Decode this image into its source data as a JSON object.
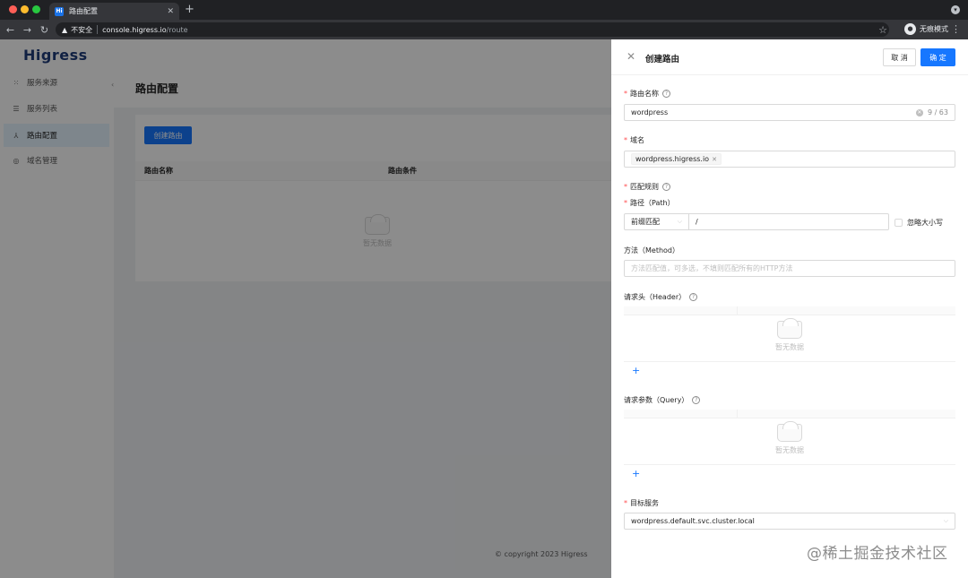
{
  "browser": {
    "tab_title": "路由配置",
    "tab_favicon": "Hi",
    "security_label": "不安全",
    "url_host": "console.higress.io",
    "url_path": "/route",
    "incognito_label": "无痕模式"
  },
  "sidebar": {
    "logo": "Higress",
    "items": [
      {
        "label": "服务来源",
        "icon": "nodes-icon"
      },
      {
        "label": "服务列表",
        "icon": "list-icon"
      },
      {
        "label": "路由配置",
        "icon": "route-icon",
        "active": true
      },
      {
        "label": "域名管理",
        "icon": "globe-icon"
      }
    ]
  },
  "page": {
    "title": "路由配置",
    "create_button": "创建路由",
    "table_headers": [
      "路由名称",
      "路由条件"
    ],
    "empty_text": "暂无数据",
    "copyright": "copyright 2023 Higress"
  },
  "drawer": {
    "title": "创建路由",
    "cancel_label": "取 消",
    "ok_label": "确 定",
    "route_name": {
      "label": "路由名称",
      "value": "wordpress",
      "counter": "9 / 63"
    },
    "domain": {
      "label": "域名",
      "tag": "wordpress.higress.io"
    },
    "match_rule": {
      "label": "匹配规则"
    },
    "path": {
      "label": "路径（Path）",
      "match_type": "前缀匹配",
      "value": "/",
      "ignore_case_label": "忽略大小写"
    },
    "method": {
      "label": "方法（Method）",
      "placeholder": "方法匹配值，可多选，不填则匹配所有的HTTP方法"
    },
    "header": {
      "label": "请求头（Header）",
      "empty_text": "暂无数据",
      "add_label": "+"
    },
    "query": {
      "label": "请求参数（Query）",
      "empty_text": "暂无数据",
      "add_label": "+"
    },
    "target_service": {
      "label": "目标服务",
      "value": "wordpress.default.svc.cluster.local"
    }
  },
  "watermark": "@稀土掘金技术社区",
  "colors": {
    "primary": "#1677ff",
    "required": "#ff4d4f",
    "overlay": "rgba(0,0,0,0.45)"
  }
}
